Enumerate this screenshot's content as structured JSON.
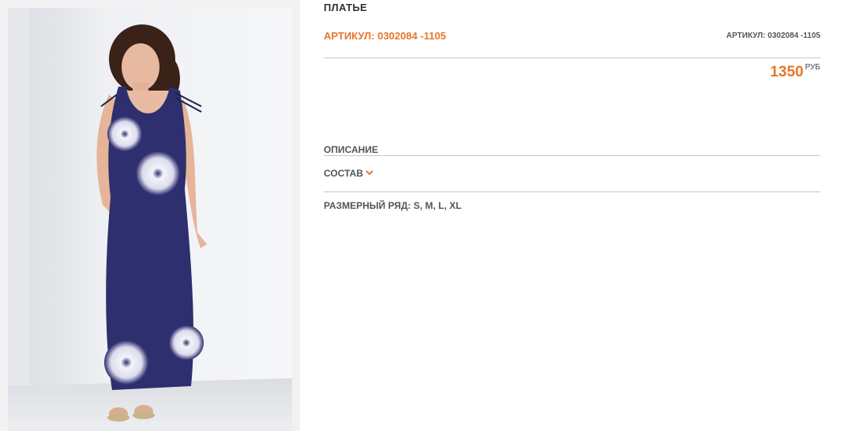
{
  "product": {
    "title": "ПЛАТЬЕ",
    "sku_main": "АРТИКУЛ: 0302084 -1105",
    "sku_secondary": "АРТИКУЛ: 0302084 -1105",
    "price_value": "1350",
    "price_unit": "РУБ",
    "description_label": "ОПИСАНИЕ",
    "composition_label": "СОСТАВ",
    "sizes_label": "РАЗМЕРНЫЙ РЯД:",
    "sizes_values": "S, M, L, XL"
  },
  "colors": {
    "accent": "#e8762c",
    "text": "#555555",
    "divider": "#c8c8c8",
    "dress": "#2e2f6e"
  },
  "icons": {
    "composition_toggle": "chevron-down-icon"
  }
}
